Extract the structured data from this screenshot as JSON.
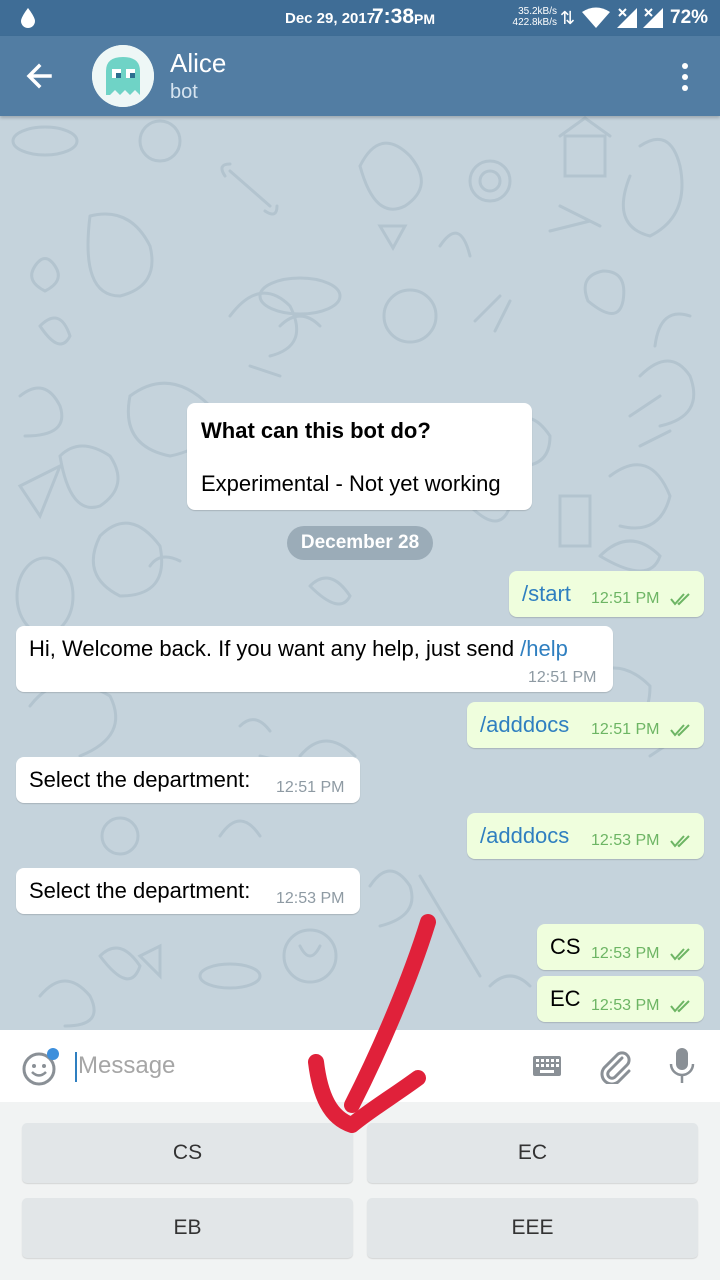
{
  "status_bar": {
    "date": "Dec 29, 2017",
    "time": "7:38",
    "ampm": "PM",
    "speed_up": "35.2kB/s",
    "speed_down": "422.8kB/s",
    "battery": "72%"
  },
  "header": {
    "name": "Alice",
    "subtitle": "bot"
  },
  "info_card": {
    "title": "What can this bot do?",
    "text": "Experimental - Not yet working"
  },
  "date_pill": "December 28",
  "messages": [
    {
      "dir": "out",
      "command": "/start",
      "time": "12:51 PM"
    },
    {
      "dir": "in",
      "text": "Hi, Welcome back. If you want any help, just send ",
      "command": "/help",
      "time": "12:51 PM"
    },
    {
      "dir": "out",
      "command": "/adddocs",
      "time": "12:51 PM"
    },
    {
      "dir": "in",
      "text": "Select the department:",
      "time": "12:51 PM"
    },
    {
      "dir": "out",
      "command": "/adddocs",
      "time": "12:53 PM"
    },
    {
      "dir": "in",
      "text": "Select the department:",
      "time": "12:53 PM"
    },
    {
      "dir": "out",
      "text": "CS",
      "time": "12:53 PM"
    },
    {
      "dir": "out",
      "text": "EC",
      "time": "12:53 PM"
    }
  ],
  "input": {
    "placeholder": "Message"
  },
  "keyboard": {
    "buttons": [
      "CS",
      "EC",
      "EB",
      "EEE"
    ]
  },
  "colors": {
    "header": "#527da3",
    "status_bar": "#3f6d96",
    "outgoing_bubble": "#effedd",
    "link": "#2f7fc0",
    "annotation_arrow": "#e0213a"
  }
}
